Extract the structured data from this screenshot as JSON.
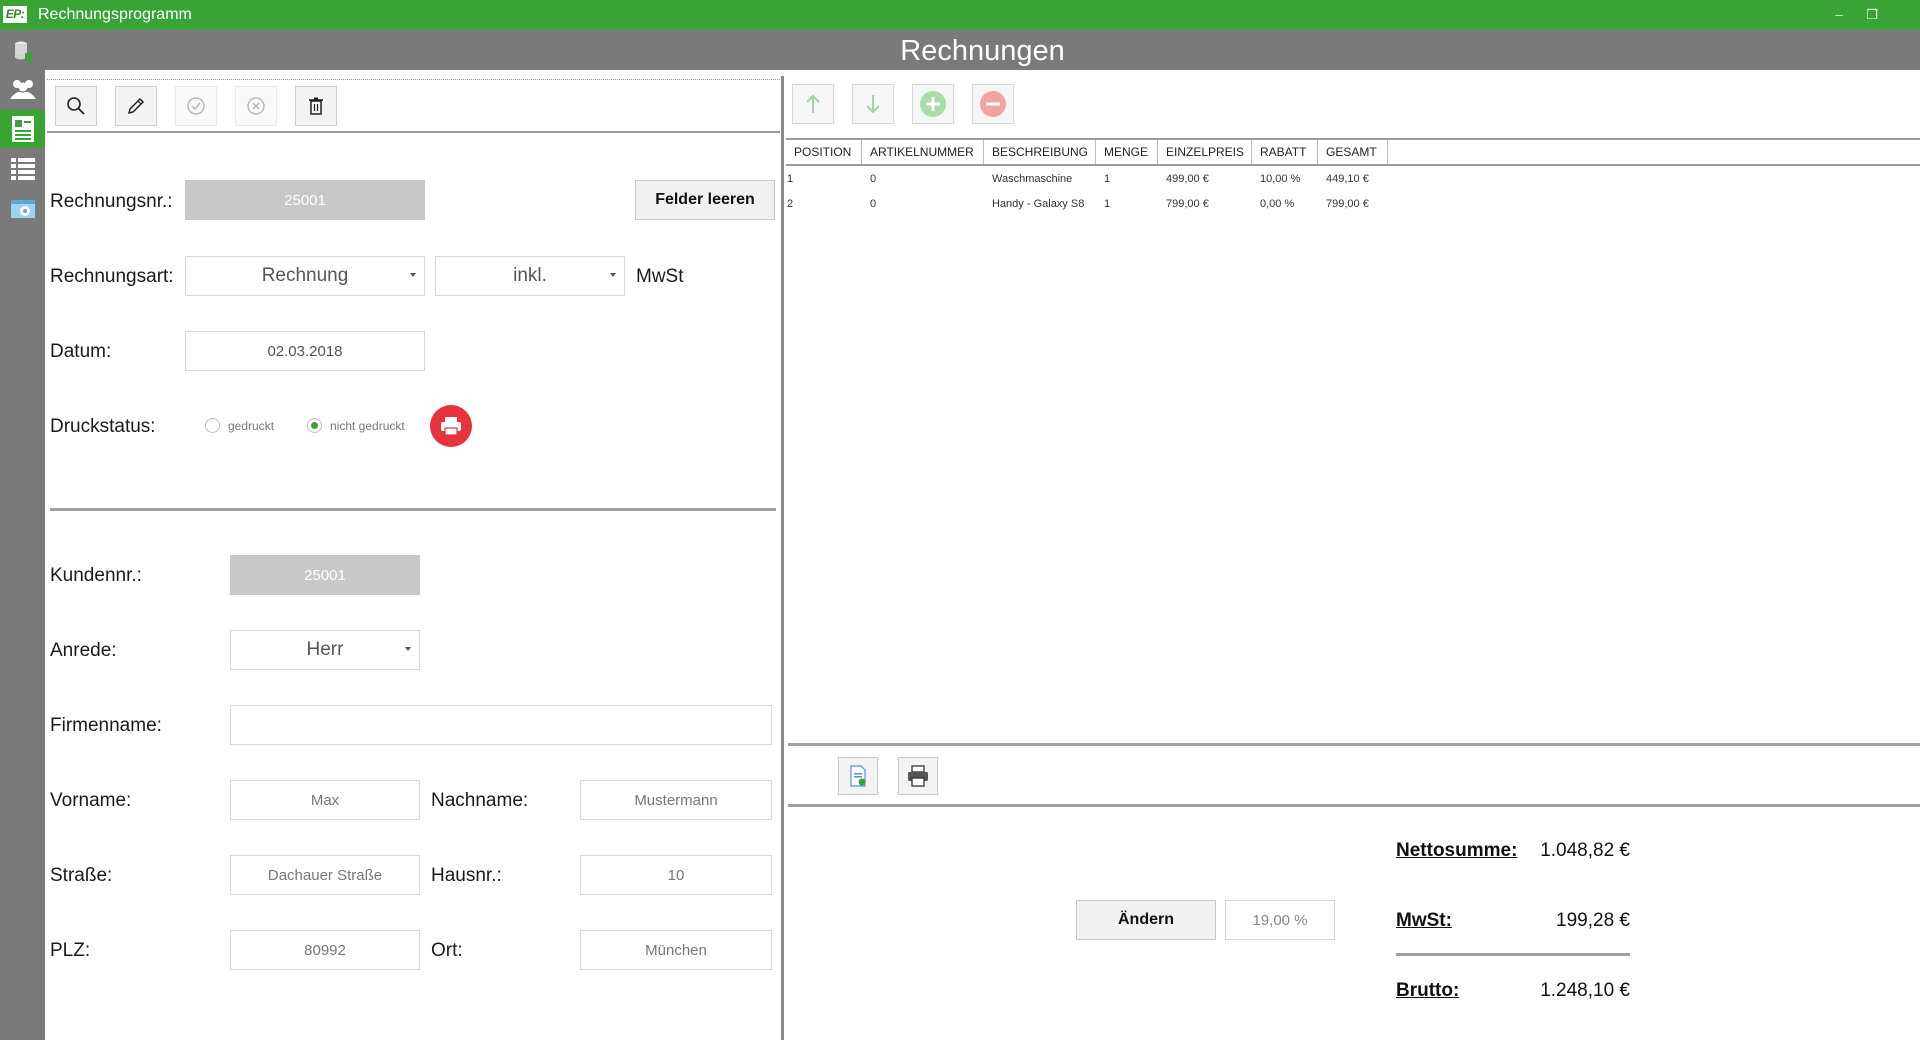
{
  "window": {
    "logo": "EP:",
    "title": "Rechnungsprogramm",
    "minimize": "–",
    "restore": "❐",
    "close": "✕"
  },
  "header": {
    "title": "Rechnungen"
  },
  "rail": {
    "items": [
      {
        "icon": "database-icon",
        "active": false
      },
      {
        "icon": "users-icon",
        "active": false
      },
      {
        "icon": "invoice-icon",
        "active": true
      },
      {
        "icon": "list-icon",
        "active": false
      },
      {
        "icon": "settings-image-icon",
        "active": false
      }
    ]
  },
  "left": {
    "toolbar": {
      "buttons": [
        {
          "icon": "search-icon",
          "enabled": true
        },
        {
          "icon": "pencil-icon",
          "enabled": true
        },
        {
          "icon": "check-circle-icon",
          "enabled": false
        },
        {
          "icon": "x-circle-icon",
          "enabled": false
        },
        {
          "icon": "trash-icon",
          "enabled": true
        }
      ]
    },
    "invoice": {
      "number_label": "Rechnungsnr.:",
      "number_value": "25001",
      "clear_button": "Felder leeren",
      "type_label": "Rechnungsart:",
      "type_value": "Rechnung",
      "tax_mode_value": "inkl.",
      "tax_suffix": "MwSt",
      "date_label": "Datum:",
      "date_value": "02.03.2018",
      "print_status_label": "Druckstatus:",
      "print_options": [
        "gedruckt",
        "nicht gedruckt"
      ],
      "print_selected": "nicht gedruckt"
    },
    "customer": {
      "number_label": "Kundennr.:",
      "number_value": "25001",
      "salutation_label": "Anrede:",
      "salutation_value": "Herr",
      "company_label": "Firmenname:",
      "company_value": "",
      "firstname_label": "Vorname:",
      "firstname_value": "Max",
      "lastname_label": "Nachname:",
      "lastname_value": "Mustermann",
      "street_label": "Straße:",
      "street_value": "Dachauer Straße",
      "house_label": "Hausnr.:",
      "house_value": "10",
      "zip_label": "PLZ:",
      "zip_value": "80992",
      "city_label": "Ort:",
      "city_value": "München"
    }
  },
  "right": {
    "toolbar": {
      "buttons": [
        {
          "icon": "arrow-up-icon"
        },
        {
          "icon": "arrow-down-icon"
        },
        {
          "icon": "add-circle-icon"
        },
        {
          "icon": "remove-circle-icon"
        }
      ]
    },
    "table": {
      "columns": [
        "POSITION",
        "ARTIKELNUMMER",
        "BESCHREIBUNG",
        "MENGE",
        "EINZELPREIS",
        "RABATT",
        "GESAMT"
      ],
      "rows": [
        [
          "1",
          "0",
          "Waschmaschine",
          "1",
          "499,00 €",
          "10,00 %",
          "449,10 €"
        ],
        [
          "2",
          "0",
          "Handy - Galaxy S8",
          "1",
          "799,00 €",
          "0,00 %",
          "799,00 €"
        ]
      ]
    },
    "actions": {
      "pdf_icon": "pdf-export-icon",
      "print_icon": "printer-icon"
    },
    "totals": {
      "net_label": "Nettosumme:",
      "net_value": "1.048,82 €",
      "vat_label": "MwSt:",
      "vat_value": "199,28 €",
      "gross_label": "Brutto:",
      "gross_value": "1.248,10 €",
      "change_button": "Ändern",
      "vat_rate": "19,00 %"
    }
  }
}
